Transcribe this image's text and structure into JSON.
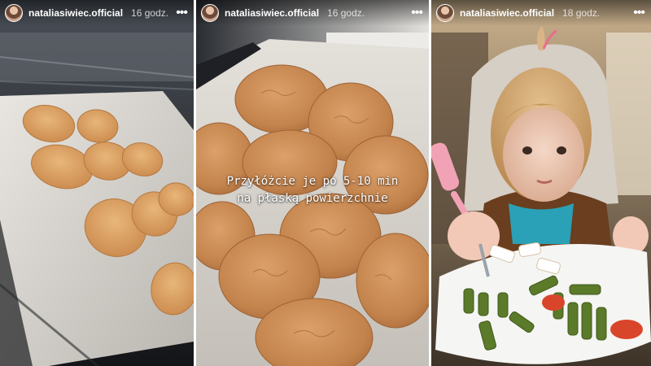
{
  "stories": [
    {
      "username": "nataliasiwiec.official",
      "time": "16 godz.",
      "avatar_icon": "profile-avatar",
      "more_icon": "•••"
    },
    {
      "username": "nataliasiwiec.official",
      "time": "16 godz.",
      "avatar_icon": "profile-avatar",
      "more_icon": "•••",
      "caption_line1": "Przyłóżcie je po 5-10 min",
      "caption_line2": "na płaską powierzchnie"
    },
    {
      "username": "nataliasiwiec.official",
      "time": "18 godz.",
      "avatar_icon": "profile-avatar",
      "more_icon": "•••"
    }
  ]
}
